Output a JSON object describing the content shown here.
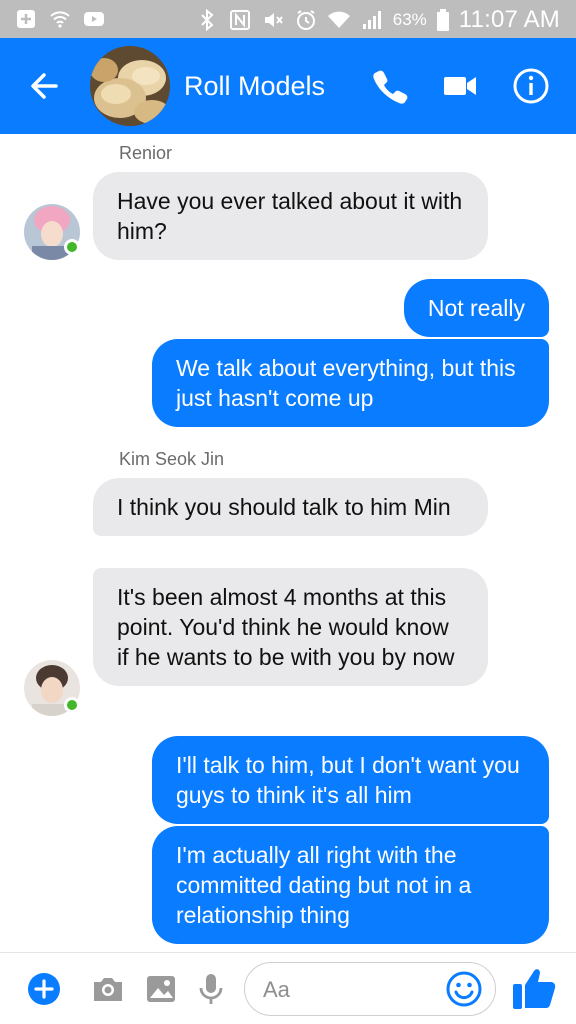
{
  "status_bar": {
    "battery_percent": "63%",
    "time": "11:07 AM",
    "left_icons": [
      "add-box-icon",
      "wifi-call-icon",
      "youtube-icon"
    ],
    "right_icons": [
      "bluetooth-icon",
      "nfc-icon",
      "mute-icon",
      "alarm-icon",
      "wifi-icon",
      "signal-icon",
      "battery-icon"
    ]
  },
  "header": {
    "title": "Roll Models",
    "background_color": "#0a7cff"
  },
  "messages": [
    {
      "sender": "Renior",
      "direction": "incoming",
      "text": "Have you ever talked about it with him?"
    },
    {
      "direction": "outgoing",
      "text": "Not really"
    },
    {
      "direction": "outgoing",
      "text": "We talk about everything, but this just hasn't come up"
    },
    {
      "sender": "Kim Seok Jin",
      "direction": "incoming",
      "text": "I think you should talk to him Min"
    },
    {
      "direction": "incoming",
      "text": "It's been almost 4 months at this point. You'd think he would know if he wants to be with you by now"
    },
    {
      "direction": "outgoing",
      "text": "I'll talk to him, but I don't want you guys to think it's all him"
    },
    {
      "direction": "outgoing",
      "text": "I'm actually all right with the committed dating but not in a relationship thing"
    }
  ],
  "composer": {
    "placeholder": "Aa",
    "accent_color": "#0a7cff"
  },
  "colors": {
    "outgoing_bubble": "#0a7cff",
    "incoming_bubble": "#e9e9eb",
    "online_dot": "#42b72a"
  }
}
